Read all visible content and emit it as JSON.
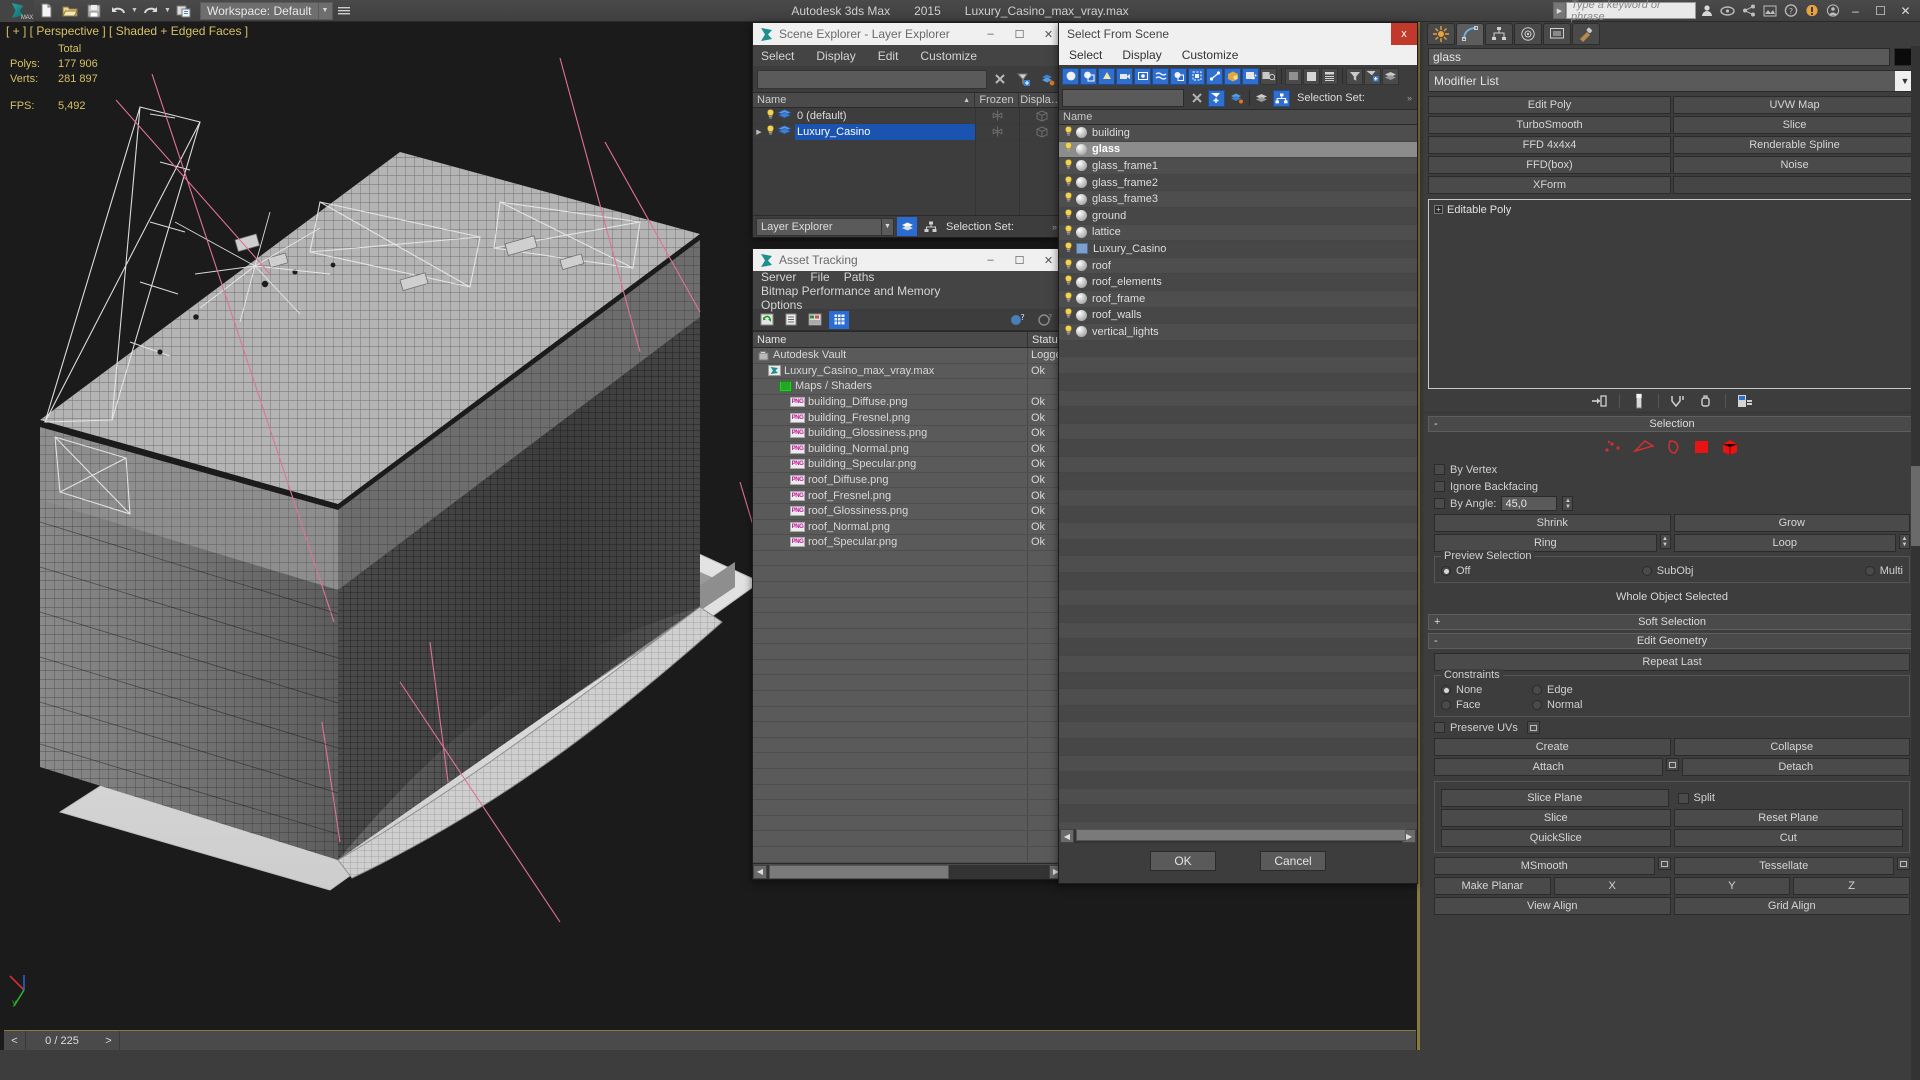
{
  "app": {
    "title_product": "Autodesk 3ds Max",
    "title_version": "2015",
    "title_file": "Luxury_Casino_max_vray.max",
    "workspace_label": "Workspace: Default",
    "search_placeholder": "Type a keyword or phrase",
    "logo_text": "MAX"
  },
  "quickaccess": [
    {
      "name": "new-file-icon",
      "label": "New"
    },
    {
      "name": "open-file-icon",
      "label": "Open"
    },
    {
      "name": "save-file-icon",
      "label": "Save"
    },
    {
      "name": "undo-icon",
      "label": "Undo"
    },
    {
      "name": "redo-icon",
      "label": "Redo"
    },
    {
      "name": "project-folder-icon",
      "label": "Set Project Folder"
    }
  ],
  "window_controls": {
    "minimize": "–",
    "maximize": "☐",
    "close": "✕"
  },
  "viewport": {
    "label": "[ + ] [ Perspective ] [ Shaded + Edged Faces ]",
    "stats": {
      "header": "Total",
      "polys_label": "Polys:",
      "polys_value": "177 906",
      "verts_label": "Verts:",
      "verts_value": "281 897",
      "fps_label": "FPS:",
      "fps_value": "5,492"
    },
    "timeline": {
      "prev": "<",
      "frame": "0 / 225",
      "next": ">"
    }
  },
  "scene_explorer": {
    "title": "Scene Explorer - Layer Explorer",
    "menus": [
      "Select",
      "Display",
      "Edit",
      "Customize"
    ],
    "search_value": "",
    "columns": [
      "Name",
      "Frozen",
      "Displa…"
    ],
    "sort_indicator": "▲",
    "rows": [
      {
        "name": "0 (default)",
        "expandable": false,
        "selected": false
      },
      {
        "name": "Luxury_Casino",
        "expandable": true,
        "selected": true
      }
    ],
    "footer": {
      "combo": "Layer Explorer",
      "selection_set_label": "Selection Set:",
      "overflow": "»"
    }
  },
  "asset_tracking": {
    "title": "Asset Tracking",
    "menus": [
      "Server",
      "File",
      "Paths",
      "Bitmap Performance and Memory",
      "Options"
    ],
    "columns": [
      "Name",
      "Status"
    ],
    "rows": [
      {
        "name": "Autodesk Vault",
        "status": "Logged",
        "icon": "vault-icon",
        "indent": 1
      },
      {
        "name": "Luxury_Casino_max_vray.max",
        "status": "Ok",
        "icon": "max-file-icon",
        "indent": 2
      },
      {
        "name": "Maps / Shaders",
        "status": "",
        "icon": "maps-icon",
        "indent": 3
      },
      {
        "name": "building_Diffuse.png",
        "status": "Ok",
        "icon": "png-icon",
        "indent": 4
      },
      {
        "name": "building_Fresnel.png",
        "status": "Ok",
        "icon": "png-icon",
        "indent": 4
      },
      {
        "name": "building_Glossiness.png",
        "status": "Ok",
        "icon": "png-icon",
        "indent": 4
      },
      {
        "name": "building_Normal.png",
        "status": "Ok",
        "icon": "png-icon",
        "indent": 4
      },
      {
        "name": "building_Specular.png",
        "status": "Ok",
        "icon": "png-icon",
        "indent": 4
      },
      {
        "name": "roof_Diffuse.png",
        "status": "Ok",
        "icon": "png-icon",
        "indent": 4
      },
      {
        "name": "roof_Fresnel.png",
        "status": "Ok",
        "icon": "png-icon",
        "indent": 4
      },
      {
        "name": "roof_Glossiness.png",
        "status": "Ok",
        "icon": "png-icon",
        "indent": 4
      },
      {
        "name": "roof_Normal.png",
        "status": "Ok",
        "icon": "png-icon",
        "indent": 4
      },
      {
        "name": "roof_Specular.png",
        "status": "Ok",
        "icon": "png-icon",
        "indent": 4
      }
    ],
    "empty_row_count": 21
  },
  "select_from_scene": {
    "title": "Select From Scene",
    "close_label": "x",
    "menus": [
      "Select",
      "Display",
      "Customize"
    ],
    "search_value": "",
    "selection_set_label": "Selection Set:",
    "column_name": "Name",
    "objects": [
      {
        "name": "building",
        "type": "geometry",
        "selected": false
      },
      {
        "name": "glass",
        "type": "geometry",
        "selected": true
      },
      {
        "name": "glass_frame1",
        "type": "geometry",
        "selected": false
      },
      {
        "name": "glass_frame2",
        "type": "geometry",
        "selected": false
      },
      {
        "name": "glass_frame3",
        "type": "geometry",
        "selected": false
      },
      {
        "name": "ground",
        "type": "geometry",
        "selected": false
      },
      {
        "name": "lattice",
        "type": "geometry",
        "selected": false
      },
      {
        "name": "Luxury_Casino",
        "type": "group",
        "selected": false
      },
      {
        "name": "roof",
        "type": "geometry",
        "selected": false
      },
      {
        "name": "roof_elements",
        "type": "geometry",
        "selected": false
      },
      {
        "name": "roof_frame",
        "type": "geometry",
        "selected": false
      },
      {
        "name": "roof_walls",
        "type": "geometry",
        "selected": false
      },
      {
        "name": "vertical_lights",
        "type": "geometry",
        "selected": false
      }
    ],
    "buttons": {
      "ok": "OK",
      "cancel": "Cancel"
    },
    "filter_icons": [
      "geometry-filter-icon",
      "shapes-filter-icon",
      "lights-filter-icon",
      "cameras-filter-icon",
      "helpers-filter-icon",
      "spacewarps-filter-icon",
      "groups-filter-icon",
      "xrefs-filter-icon",
      "bones-filter-icon",
      "containers-filter-icon",
      "particles-filter-icon",
      "extras-filter-icon",
      "list-view-icon",
      "flat-view-icon",
      "column-view-icon",
      "filter-icon",
      "filter-add-icon",
      "layers-icon"
    ]
  },
  "command_panel": {
    "tabs": [
      {
        "name": "create-tab",
        "label": "Create",
        "active": false
      },
      {
        "name": "modify-tab",
        "label": "Modify",
        "active": true
      },
      {
        "name": "hierarchy-tab",
        "label": "Hierarchy",
        "active": false
      },
      {
        "name": "motion-tab",
        "label": "Motion",
        "active": false
      },
      {
        "name": "display-tab",
        "label": "Display",
        "active": false
      },
      {
        "name": "utilities-tab",
        "label": "Utilities",
        "active": false
      }
    ],
    "object_name": "glass",
    "modifier_list_label": "Modifier List",
    "modifier_buttons": [
      "Edit Poly",
      "UVW Map",
      "TurboSmooth",
      "Slice",
      "FFD 4x4x4",
      "Renderable Spline",
      "FFD(box)",
      "Noise",
      "XForm",
      ""
    ],
    "stack_items": [
      {
        "label": "Editable Poly",
        "expander": "+"
      }
    ],
    "stack_icons": [
      "pin-stack-icon",
      "show-end-result-icon",
      "make-unique-icon",
      "remove-modifier-icon",
      "configure-sets-icon"
    ],
    "selection": {
      "title": "Selection",
      "expander": "-",
      "sub_object_modes": [
        "vertex-icon",
        "edge-icon",
        "border-icon",
        "polygon-icon",
        "element-icon"
      ],
      "by_vertex": "By Vertex",
      "ignore_backfacing": "Ignore Backfacing",
      "by_angle": "By Angle:",
      "by_angle_value": "45,0",
      "shrink": "Shrink",
      "grow": "Grow",
      "ring": "Ring",
      "loop": "Loop",
      "preview_selection_label": "Preview Selection",
      "preview_options": [
        "Off",
        "SubObj",
        "Multi"
      ],
      "preview_selected": "Off",
      "status": "Whole Object Selected"
    },
    "soft_selection": {
      "title": "Soft Selection",
      "expander": "+"
    },
    "edit_geometry": {
      "title": "Edit Geometry",
      "expander": "-",
      "repeat_last": "Repeat Last",
      "constraints_label": "Constraints",
      "constraints": [
        "None",
        "Edge",
        "Face",
        "Normal"
      ],
      "constraint_selected": "None",
      "preserve_uvs": "Preserve UVs",
      "create": "Create",
      "collapse": "Collapse",
      "attach": "Attach",
      "detach": "Detach",
      "slice_plane": "Slice Plane",
      "split": "Split",
      "slice": "Slice",
      "reset_plane": "Reset Plane",
      "quickslice": "QuickSlice",
      "cut": "Cut",
      "msmooth": "MSmooth",
      "tessellate": "Tessellate",
      "make_planar": "Make Planar",
      "axis_x": "X",
      "axis_y": "Y",
      "axis_z": "Z",
      "view_align": "View Align",
      "grid_align": "Grid Align"
    }
  },
  "colors": {
    "accent_blue": "#2b6bd4",
    "selection_blue": "#1a53b0",
    "viewport_yellow": "#d6c063",
    "panel_bg": "#3d3d3d",
    "window_bg": "#4a4a4a",
    "close_red": "#c0392b",
    "edge_highlight": "#e0719c"
  }
}
